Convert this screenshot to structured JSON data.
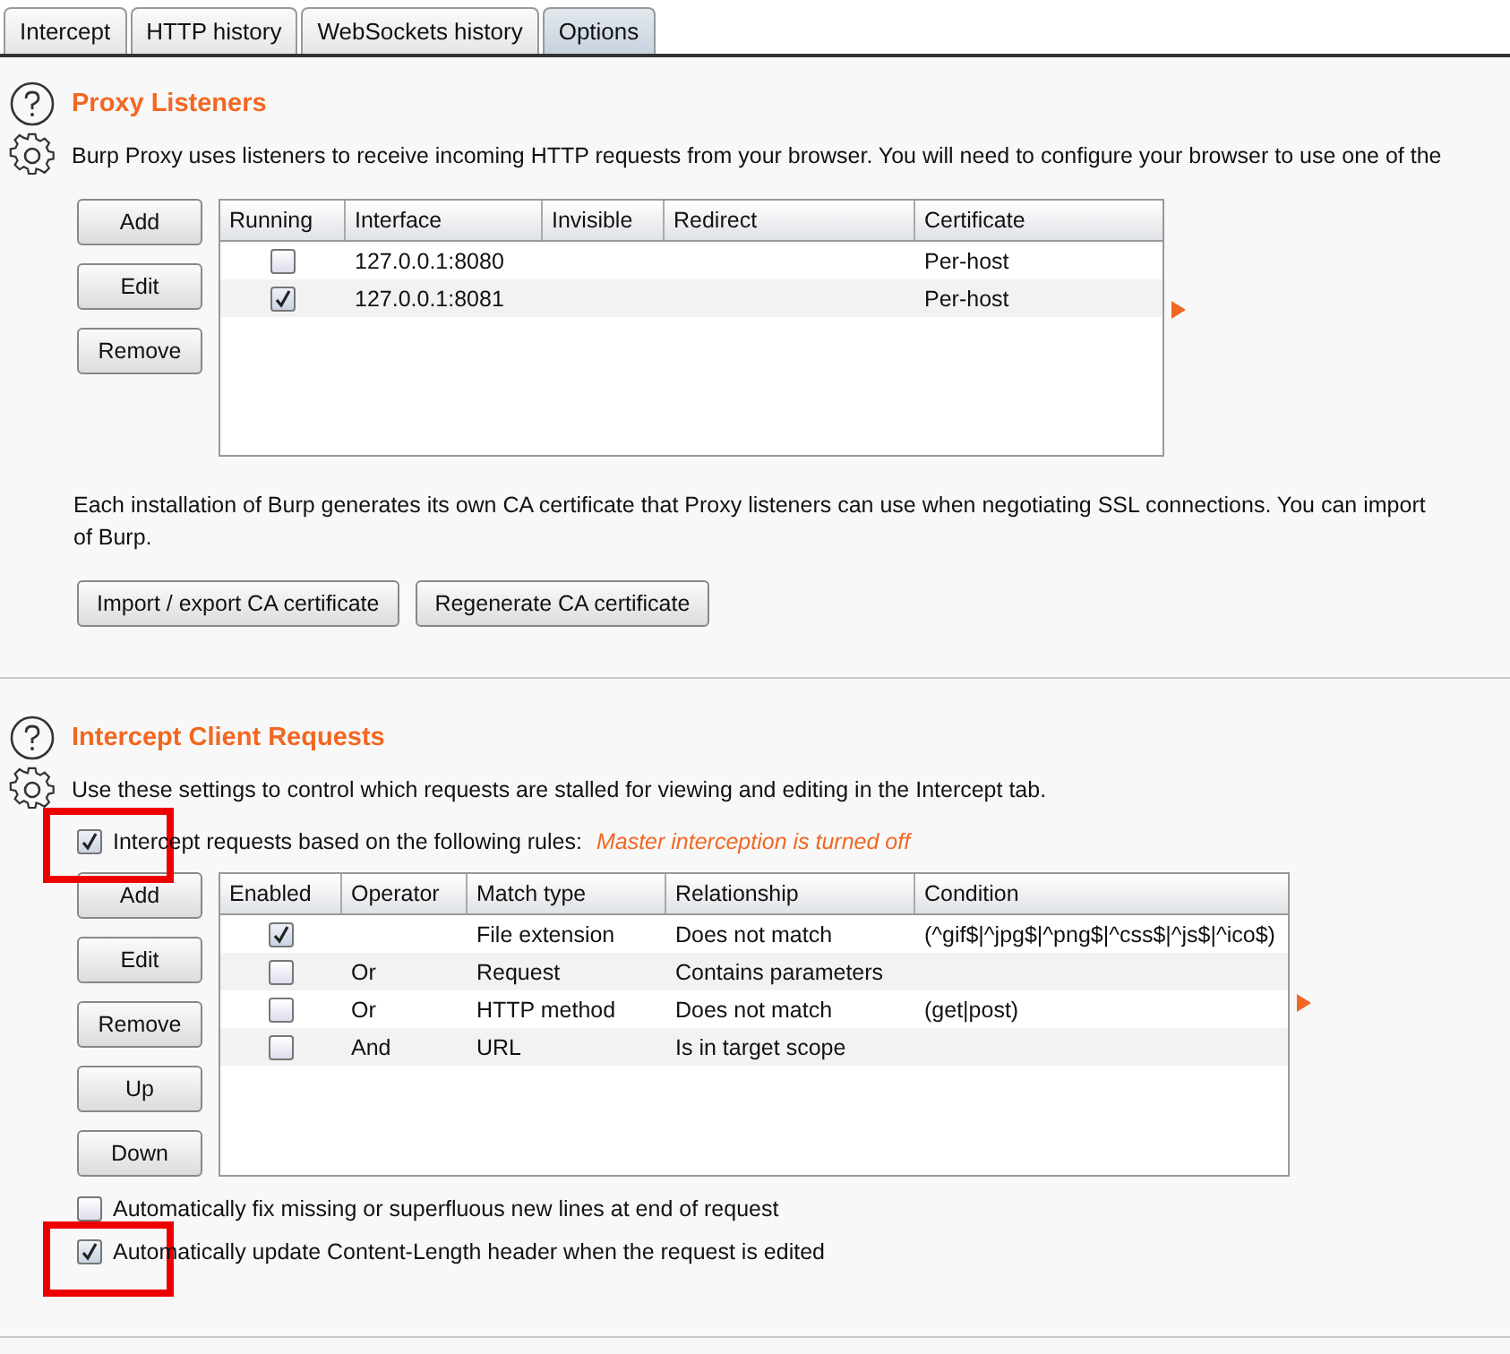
{
  "tabs": [
    {
      "label": "Intercept",
      "selected": false
    },
    {
      "label": "HTTP history",
      "selected": false
    },
    {
      "label": "WebSockets history",
      "selected": false
    },
    {
      "label": "Options",
      "selected": true
    }
  ],
  "proxy_listeners": {
    "title": "Proxy Listeners",
    "description": "Burp Proxy uses listeners to receive incoming HTTP requests from your browser. You will need to configure your browser to use one of the",
    "buttons": [
      "Add",
      "Edit",
      "Remove"
    ],
    "table": {
      "columns": [
        "Running",
        "Interface",
        "Invisible",
        "Redirect",
        "Certificate"
      ],
      "rows": [
        {
          "running": false,
          "interface": "127.0.0.1:8080",
          "certificate": "Per-host"
        },
        {
          "running": true,
          "interface": "127.0.0.1:8081",
          "certificate": "Per-host"
        }
      ]
    },
    "ca_note": "Each installation of Burp generates its own CA certificate that Proxy listeners can use when negotiating SSL connections. You can import",
    "ca_note_line2": "of Burp.",
    "ca_buttons": [
      "Import / export CA certificate",
      "Regenerate CA certificate"
    ]
  },
  "intercept_client_requests": {
    "title": "Intercept Client Requests",
    "description": "Use these settings to control which requests are stalled for viewing and editing in the Intercept tab.",
    "rules_option": {
      "label": "Intercept requests based on the following rules:",
      "checked": true,
      "highlighted": true,
      "status": "Master interception is turned off"
    },
    "buttons": [
      "Add",
      "Edit",
      "Remove",
      "Up",
      "Down"
    ],
    "table": {
      "columns": [
        "Enabled",
        "Operator",
        "Match type",
        "Relationship",
        "Condition"
      ],
      "rows": [
        {
          "enabled": true,
          "match_type": "File extension",
          "relationship": "Does not match",
          "condition": "(^gif$|^jpg$|^png$|^css$|^js$|^ico$)"
        },
        {
          "enabled": false,
          "operator": "Or",
          "match_type": "Request",
          "relationship": "Contains parameters"
        },
        {
          "enabled": false,
          "operator": "Or",
          "match_type": "HTTP method",
          "relationship": "Does not match",
          "condition": "(get|post)"
        },
        {
          "enabled": false,
          "operator": "And",
          "match_type": "URL",
          "relationship": "Is in target scope"
        }
      ]
    },
    "options": [
      {
        "label": "Automatically fix missing or superfluous new lines at end of request",
        "checked": false,
        "highlighted": false
      },
      {
        "label": "Automatically update Content-Length header when the request is edited",
        "checked": true,
        "highlighted": true
      }
    ]
  }
}
